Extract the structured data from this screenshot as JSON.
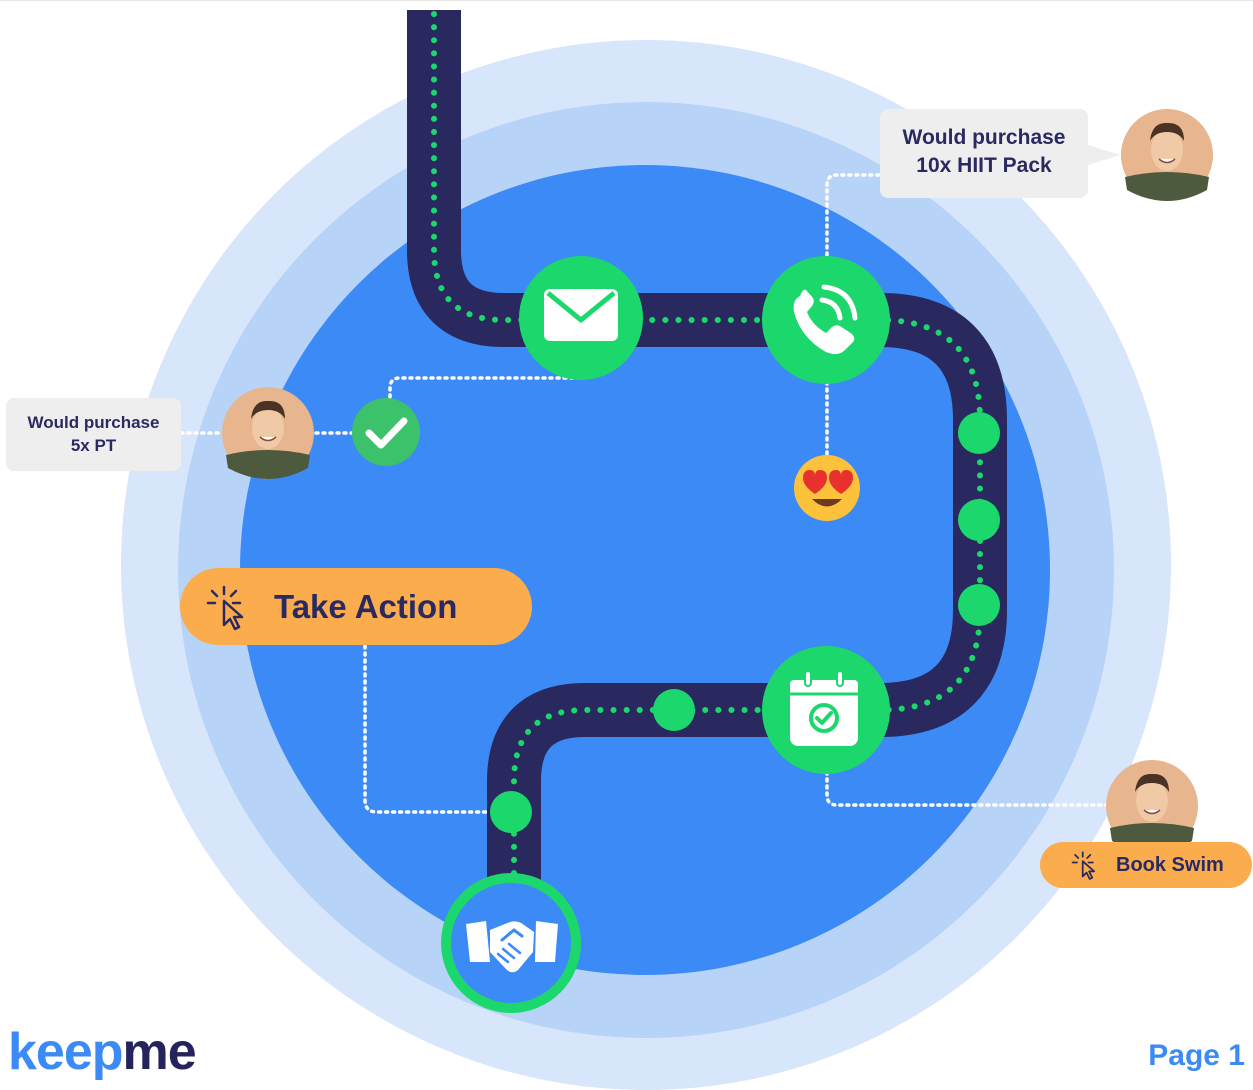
{
  "colors": {
    "ring_outer": "#d7e6fb",
    "ring_middle": "#b7d4f8",
    "core": "#3b8af5",
    "track": "#29285f",
    "node_green": "#1cd86c",
    "dots": "#1cd86c",
    "check_green": "#3cc26b",
    "tag_bg": "#eeeeee",
    "pill_orange": "#fbac4c",
    "text_navy": "#2a2a62",
    "brand_blue": "#3b8af5",
    "brand_navy": "#24235c"
  },
  "steps": [
    {
      "icon": "envelope-icon"
    },
    {
      "icon": "phone-icon"
    },
    {
      "icon": "calendar-check-icon"
    },
    {
      "icon": "handshake-icon"
    }
  ],
  "callouts": {
    "left_tag": {
      "line1": "Would purchase",
      "line2": "5x PT"
    },
    "right_tag": {
      "line1": "Would purchase",
      "line2": "10x HIIT Pack"
    },
    "take_action": "Take Action",
    "book_swim": "Book Swim"
  },
  "reactions": {
    "emoji": "heart-eyes-emoji",
    "check": "check-icon"
  },
  "footer": {
    "brand_part1": "keep",
    "brand_part2": "me",
    "page_label": "Page 1"
  }
}
